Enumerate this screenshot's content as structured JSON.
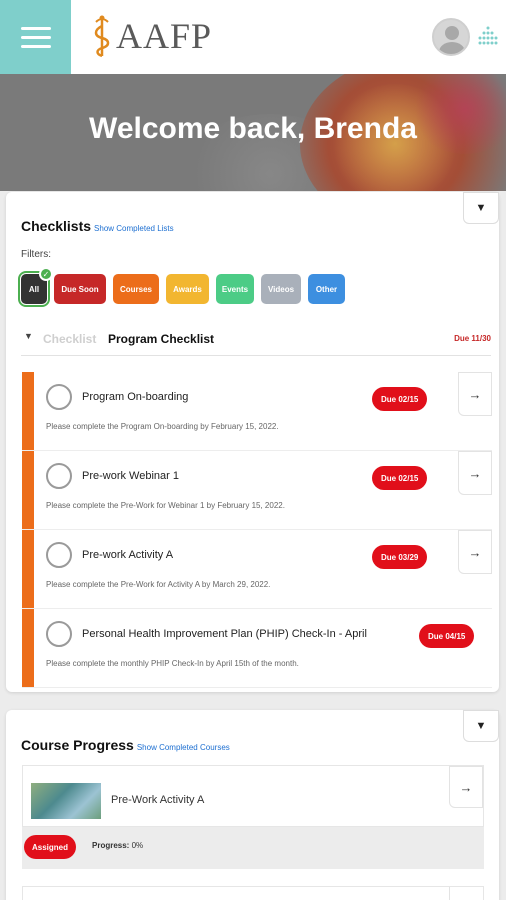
{
  "header": {
    "logo_text": "AAFP",
    "avatar_alt": "user avatar"
  },
  "hero": {
    "welcome": "Welcome back, Brenda"
  },
  "checklists": {
    "title": "Checklists",
    "show_completed": "Show Completed Lists",
    "filters_label": "Filters:",
    "filters": [
      {
        "label": "All",
        "color": "#333333",
        "active": true
      },
      {
        "label": "Due Soon",
        "color": "#c62828"
      },
      {
        "label": "Courses",
        "color": "#ec6d1a"
      },
      {
        "label": "Awards",
        "color": "#f2b630"
      },
      {
        "label": "Events",
        "color": "#4ccc86"
      },
      {
        "label": "Videos",
        "color": "#a9b0ba"
      },
      {
        "label": "Other",
        "color": "#3d8fe0"
      }
    ],
    "section": {
      "prefix": "Checklist",
      "name": "Program Checklist",
      "due": "Due 11/30"
    },
    "items": [
      {
        "title": "Program On-boarding",
        "desc": "Please complete the Program On-boarding by February 15, 2022.",
        "badge": "Due 02/15"
      },
      {
        "title": "Pre-work Webinar 1",
        "desc": "Please complete the Pre-Work for Webinar 1 by February 15, 2022.",
        "badge": "Due 02/15"
      },
      {
        "title": "Pre-work Activity A",
        "desc": "Please complete the Pre-Work for Activity A by March 29, 2022.",
        "badge": "Due 03/29"
      },
      {
        "title": "Personal Health Improvement Plan (PHIP) Check-In - April",
        "desc": "Please complete the monthly PHIP Check-In by April 15th of the month.",
        "badge": "Due 04/15"
      }
    ]
  },
  "course_progress": {
    "title": "Course Progress",
    "show_completed": "Show Completed Courses",
    "course": {
      "name": "Pre-Work Activity A",
      "status": "Assigned",
      "progress_label": "Progress:",
      "progress_value": "0%"
    }
  }
}
